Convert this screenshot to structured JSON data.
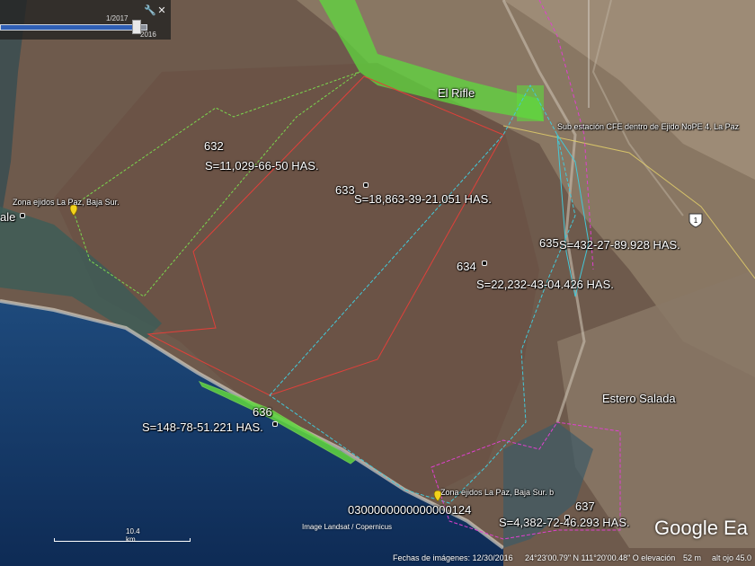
{
  "time_slider": {
    "date_top": "1/2017",
    "date_bottom": "2016",
    "fill_fraction": 0.93
  },
  "labels": {
    "p632_id": "632",
    "p632_area": "S=11,029-66-50 HAS.",
    "p633_id": "633",
    "p633_area": "S=18,863-39-21.051 HAS.",
    "p634_id": "634",
    "p634_area": "S=22,232-43-04.426 HAS.",
    "p635_id": "635",
    "p635_area": "S=432-27-89.928 HAS.",
    "p636_id": "636",
    "p636_area": "S=148-78-51.221 HAS.",
    "p637_id": "637",
    "p637_area": "S=4,382-72-46.293 HAS.",
    "el_rifle": "El Rifle",
    "substation": "Sub estación CFE dentro de Ejido NoPE 4. La Paz",
    "zona_ejidos_1": "Zona ejidos  La Paz, Baja Sur.",
    "zona_ejidos_2": "Zona ejidos  La Paz, Baja Sur. b",
    "ale": "ale",
    "estero_salada": "Estero Salada",
    "code_number": "0300000000000000124",
    "highway": "1"
  },
  "scale": {
    "label": "10.4 km"
  },
  "credit": "Image Landsat / Copernicus",
  "logo": "Google Ea",
  "status": {
    "date": "Fechas de imágenes: 12/30/2016",
    "coords": "24°23'00.79\" N  111°20'00.48\" O  elevación",
    "elevation": "52 m",
    "altitude": "alt ojo 45.0"
  },
  "icons": [
    "wrench-icon",
    "close-icon",
    "placemark-icon",
    "highway-shield-icon"
  ],
  "colors": {
    "green_boundary": "#7bd84e",
    "red_boundary": "#e0403a",
    "cyan_boundary": "#43c8d8",
    "magenta_boundary": "#e040d0",
    "pin_yellow": "#f2d21b"
  }
}
